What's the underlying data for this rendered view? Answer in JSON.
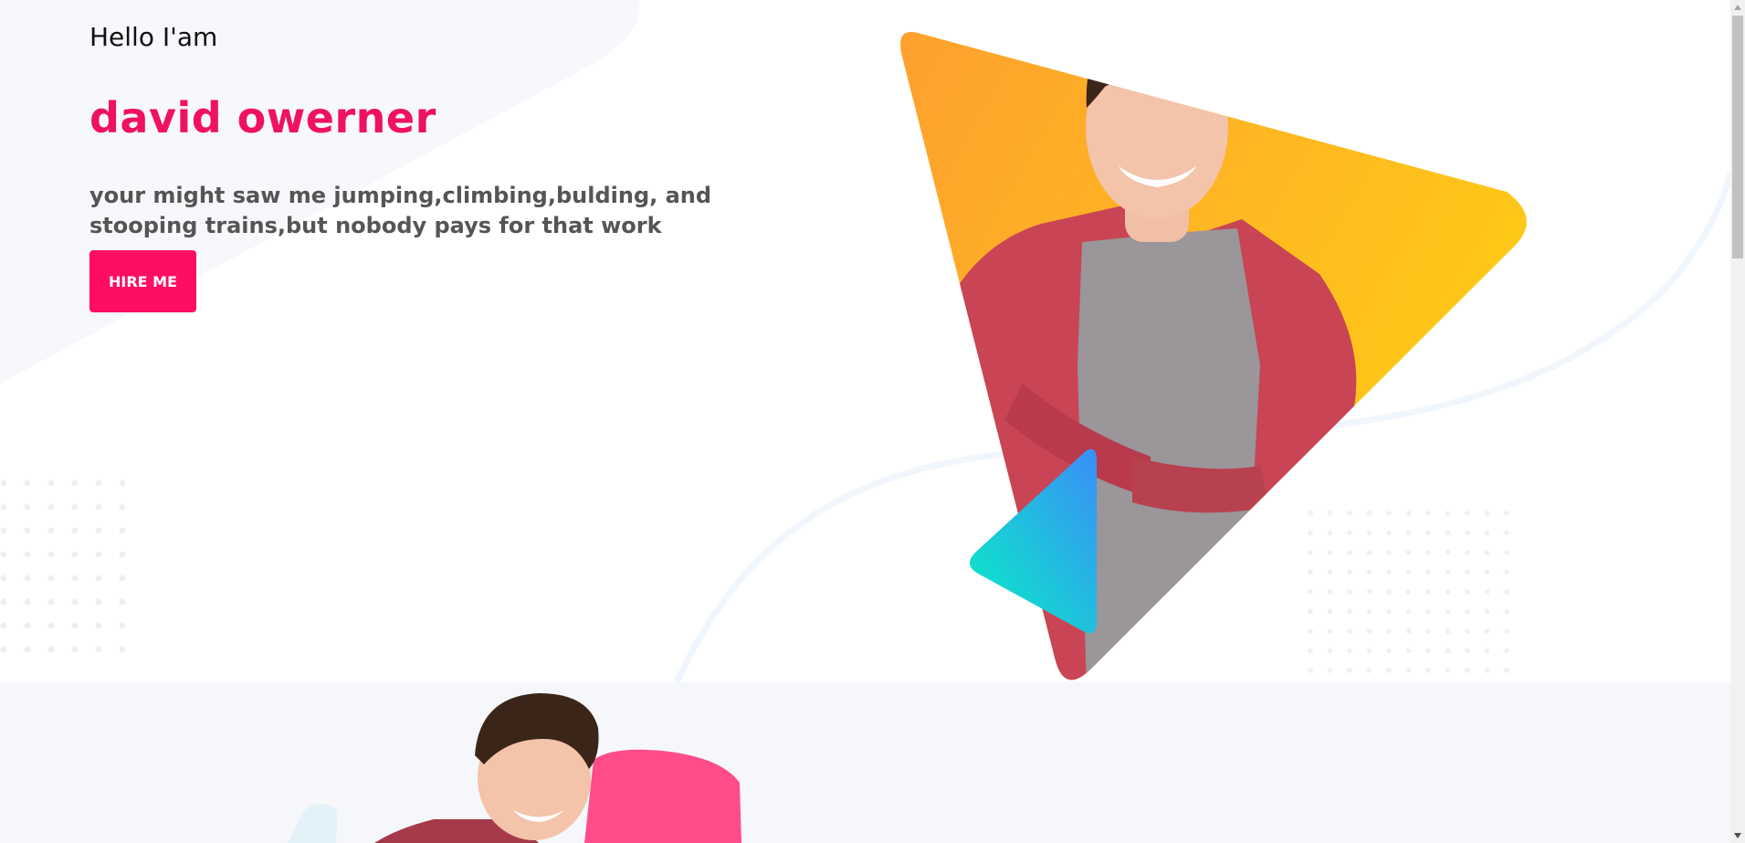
{
  "hero": {
    "greeting": "Hello I'am",
    "name": "david owerner",
    "tagline": "your might saw me jumping,climbing,bulding, and stooping trains,but nobody pays for that work",
    "hire_button_label": "HIRE ME"
  },
  "colors": {
    "accent": "#fe0e63",
    "name_color": "#f0115f",
    "triangle_orange": "#fea02f",
    "triangle_yellow": "#fece14",
    "triangle_teal": "#07f0c3",
    "triangle_blue": "#3a8ef9",
    "section_two_bg": "#f6f7fb"
  },
  "icons": {
    "scroll_up": "triangle-up-icon",
    "scroll_down": "triangle-down-icon"
  }
}
